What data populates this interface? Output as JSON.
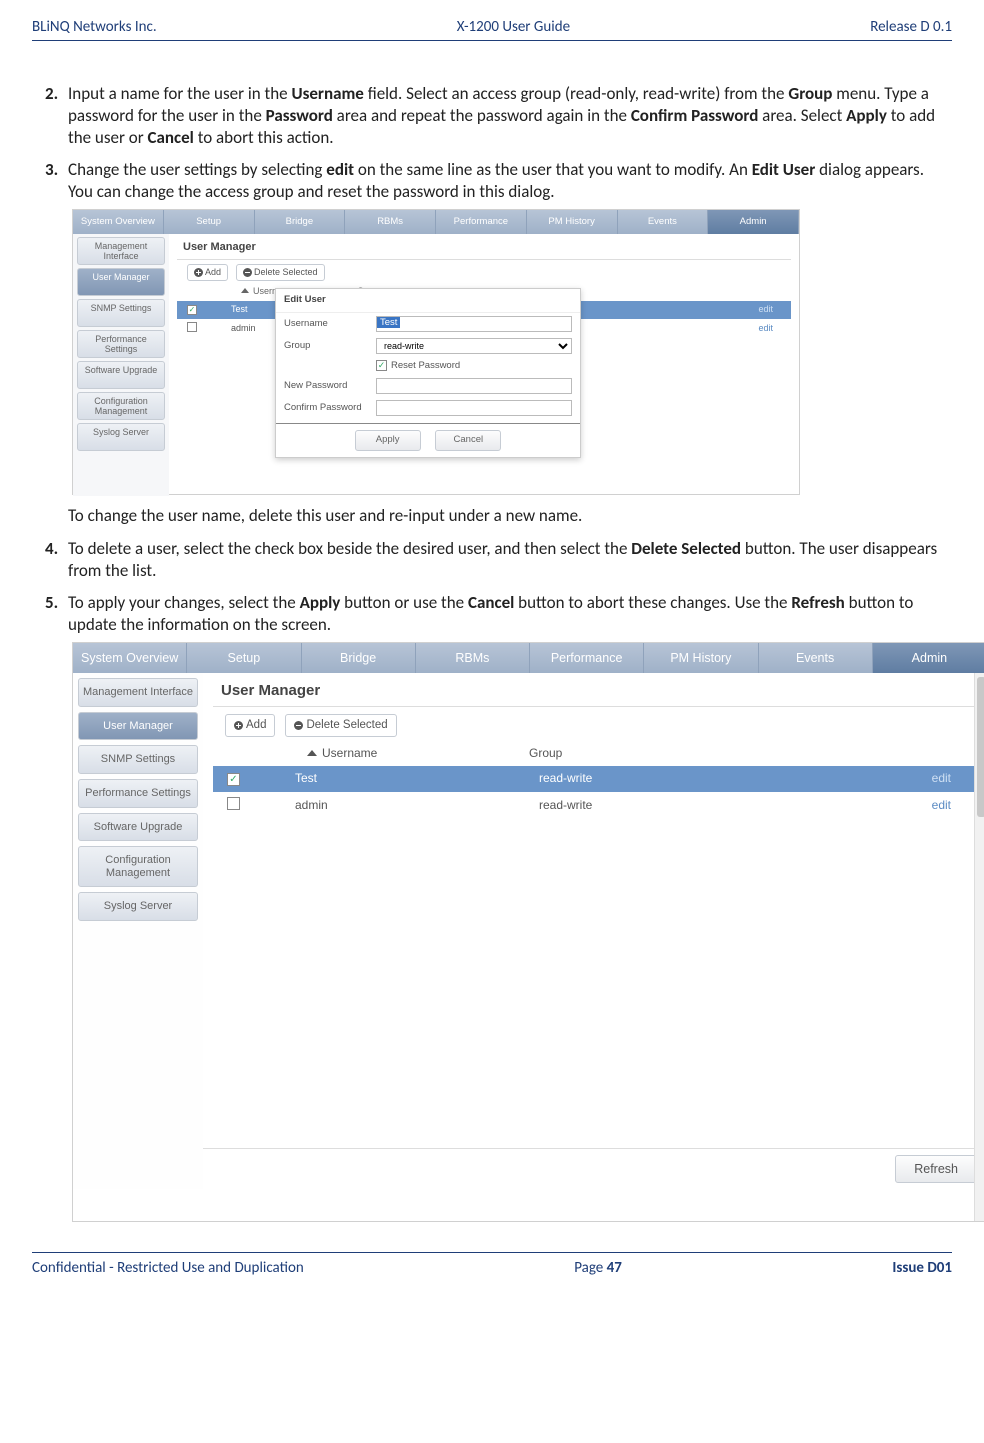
{
  "header": {
    "left": "BLiNQ Networks Inc.",
    "center": "X-1200 User Guide",
    "right": "Release D 0.1"
  },
  "footer": {
    "left": "Confidential - Restricted Use and Duplication",
    "center_prefix": "Page ",
    "page_num": "47",
    "right": "Issue D01"
  },
  "steps": {
    "s2": {
      "t": "Input a name for the user in the ",
      "b1": "Username",
      "t2": " field. Select an access group (read-only, read-write) from the ",
      "b2": "Group",
      "t3": " menu. Type a password for the user in the ",
      "b3": "Password",
      "t4": " area and repeat the password again in the ",
      "b4": "Confirm Password",
      "t5": " area. Select ",
      "b5": "Apply",
      "t6": " to add the user or ",
      "b6": "Cancel",
      "t7": " to abort this action."
    },
    "s3": {
      "t": "Change the user settings by selecting ",
      "b1": "edit",
      "t2": " on the same line as the user that you want to modify. An ",
      "b2": "Edit User",
      "t3": " dialog appears. You can change the access group and reset the password in this dialog."
    },
    "s3_after": "To change the user name, delete this user and re-input under a new name.",
    "s4": {
      "t": "To delete a user, select the check box beside the desired user, and then select the ",
      "b1": "Delete Selected",
      "t2": " button. The user disappears from the list."
    },
    "s5": {
      "t": "To apply your changes, select the ",
      "b1": "Apply",
      "t2": " button or use the ",
      "b2": "Cancel",
      "t3": " button to abort these changes. Use the ",
      "b3": "Refresh",
      "t4": " button to update the information on the screen."
    }
  },
  "ui": {
    "tabs": [
      "System Overview",
      "Setup",
      "Bridge",
      "RBMs",
      "Performance",
      "PM History",
      "Events",
      "Admin"
    ],
    "sidebar": [
      "Management Interface",
      "User Manager",
      "SNMP Settings",
      "Performance Settings",
      "Software Upgrade",
      "Configuration Management",
      "Syslog Server"
    ],
    "panel_title": "User Manager",
    "btn_add": "Add",
    "btn_delete_selected": "Delete Selected",
    "col_user": "Username",
    "col_group": "Group",
    "rows": [
      {
        "checked": true,
        "user": "Test",
        "group": "read-write",
        "edit": "edit"
      },
      {
        "checked": false,
        "user": "admin",
        "group": "read-write",
        "edit": "edit"
      }
    ],
    "dialog": {
      "title": "Edit User",
      "lbl_user": "Username",
      "val_user": "Test",
      "lbl_group": "Group",
      "val_group": "read-write",
      "cb_reset": "Reset Password",
      "lbl_newpw": "New Password",
      "lbl_confpw": "Confirm Password",
      "btn_apply": "Apply",
      "btn_cancel": "Cancel"
    },
    "btn_refresh": "Refresh"
  }
}
